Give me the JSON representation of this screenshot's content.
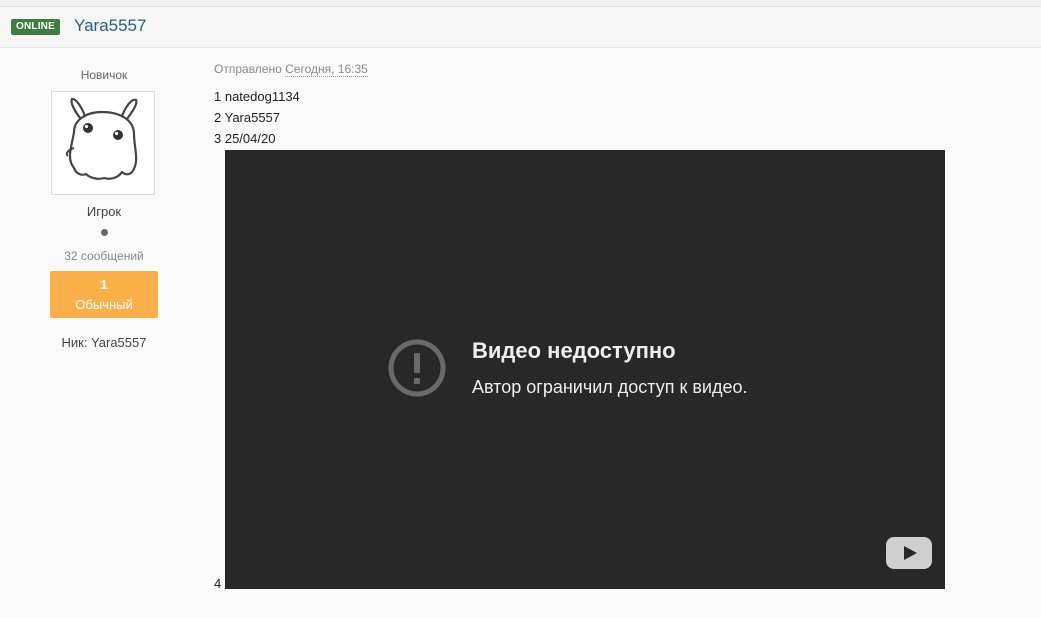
{
  "header": {
    "status_badge": "ONLINE",
    "author_name": "Yara5557"
  },
  "author": {
    "rank_title": "Новичок",
    "group": "Игрок",
    "post_count": "32 сообщений",
    "reputation_value": "1",
    "reputation_label": "Обычный",
    "nick_line": "Ник: Yara5557",
    "avatar_icon": "bunny-avatar-icon"
  },
  "post": {
    "sent_label": "Отправлено",
    "sent_time": "Сегодня, 16:35",
    "lines": [
      "1 natedog1134",
      "2 Yara5557",
      "3 25/04/20",
      "4"
    ]
  },
  "video": {
    "title": "Видео недоступно",
    "message": "Автор ограничил доступ к видео.",
    "icons": [
      "alert-circle-icon",
      "youtube-logo-icon"
    ]
  },
  "colors": {
    "online_badge": "#3f7d3e",
    "author_link": "#2b5d85",
    "reputation_box": "#f9b04a",
    "video_background": "#282828"
  }
}
